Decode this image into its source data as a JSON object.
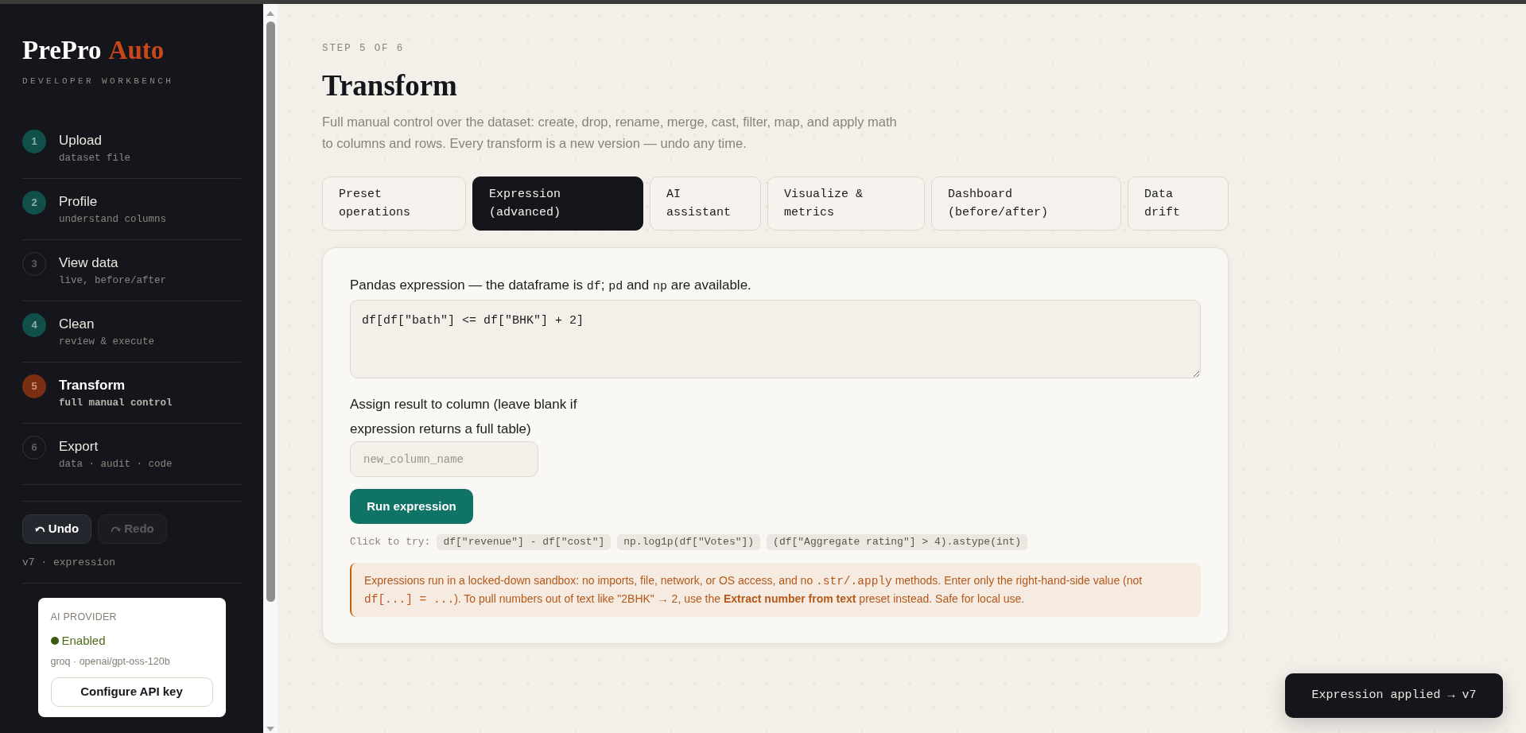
{
  "sidebar": {
    "brand": {
      "name": "PrePro",
      "accent": "Auto"
    },
    "tagline": "DEVELOPER WORKBENCH",
    "steps": [
      {
        "number": "1",
        "title": "Upload",
        "subtitle": "dataset file",
        "done": true,
        "selected": false
      },
      {
        "number": "2",
        "title": "Profile",
        "subtitle": "understand columns",
        "done": true,
        "selected": false
      },
      {
        "number": "3",
        "title": "View data",
        "subtitle": "live, before/after",
        "done": false,
        "selected": false
      },
      {
        "number": "4",
        "title": "Clean",
        "subtitle": "review & execute",
        "done": true,
        "selected": false
      },
      {
        "number": "5",
        "title": "Transform",
        "subtitle": "full manual control",
        "done": false,
        "selected": true
      },
      {
        "number": "6",
        "title": "Export",
        "subtitle": "data · audit · code",
        "done": false,
        "selected": false
      }
    ],
    "history": {
      "buttons": [
        {
          "kind": "undo",
          "label": "Undo",
          "disabled": false
        },
        {
          "kind": "redo",
          "label": "Redo",
          "disabled": true
        }
      ],
      "version": "v7 · expression"
    },
    "ai_provider": {
      "heading": "AI PROVIDER",
      "status": "Enabled",
      "enabled": true,
      "model": "groq · openai/gpt-oss-120b",
      "button": "Configure API key"
    }
  },
  "page": {
    "step_label": "STEP 5 OF 6",
    "title": "Transform",
    "description": "Full manual control over the dataset: create, drop, rename, merge, cast, filter, map, and apply math to columns and rows. Every transform is a new version — undo any time."
  },
  "tabs": [
    {
      "label": "Preset operations",
      "selected": false
    },
    {
      "label": "Expression (advanced)",
      "selected": true
    },
    {
      "label": "AI assistant",
      "selected": false
    },
    {
      "label": "Visualize & metrics",
      "selected": false
    },
    {
      "label": "Dashboard (before/after)",
      "selected": false
    },
    {
      "label": "Data drift",
      "selected": false
    }
  ],
  "expression_panel": {
    "expression_label": [
      {
        "kind": "text",
        "text": "Pandas expression — the dataframe is "
      },
      {
        "kind": "code",
        "text": "df"
      },
      {
        "kind": "text",
        "text": "; "
      },
      {
        "kind": "code",
        "text": "pd"
      },
      {
        "kind": "text",
        "text": " and "
      },
      {
        "kind": "code",
        "text": "np"
      },
      {
        "kind": "text",
        "text": " are available."
      }
    ],
    "expression_value": "df[df[\"bath\"] <= df[\"BHK\"] + 2]",
    "assign_label": "Assign result to column (leave blank if expression returns a full table)",
    "column_placeholder": "new_column_name",
    "run_button": "Run expression",
    "examples_label": "Click to try:",
    "examples": [
      "df[\"revenue\"] - df[\"cost\"]",
      "np.log1p(df[\"Votes\"])",
      "(df[\"Aggregate rating\"] > 4).astype(int)"
    ],
    "notice": [
      {
        "kind": "text",
        "text": "Expressions run in a locked-down sandbox: no imports, file, network, or OS access, and no "
      },
      {
        "kind": "code",
        "text": ".str/.apply"
      },
      {
        "kind": "text",
        "text": " methods. Enter only the right-hand-side value (not "
      },
      {
        "kind": "code",
        "text": "df[...] = ..."
      },
      {
        "kind": "text",
        "text": "). To pull numbers out of text like \"2BHK\" → 2, use the "
      },
      {
        "kind": "strong",
        "text": "Extract number from text"
      },
      {
        "kind": "text",
        "text": " preset instead. Safe for local use."
      }
    ]
  },
  "toast": "Expression applied → v7"
}
